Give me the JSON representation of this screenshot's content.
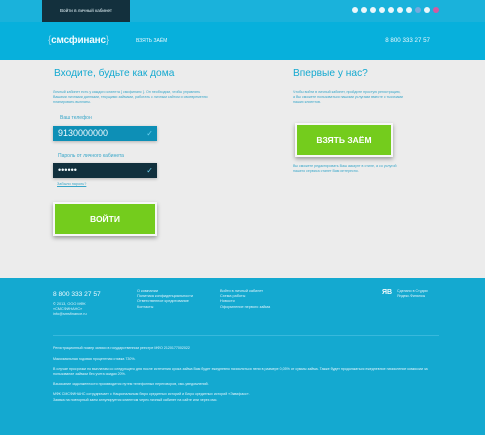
{
  "topbar": {
    "login_tab": "Войти в личный кабинет"
  },
  "header": {
    "logo_prefix": "{",
    "logo_text": "смсфинанс",
    "logo_suffix": "}",
    "loan_link": "ВЗЯТЬ ЗАЁМ",
    "phone": "8 800 333 27 57"
  },
  "login": {
    "title": "Входите, будьте как дома",
    "intro": "Личный кабинет есть у каждого клиента { смсфинанс }. Он необходим, чтобы управлять Вашими личными данными, текущими займами, работать с личным сайтом и своевременно планировать выплаты.",
    "phone_label": "Ваш телефон",
    "phone_value": "9130000000",
    "password_label": "Пароль от личного кабинета",
    "password_value": "••••••",
    "forgot": "Забыли пароль?",
    "button": "ВОЙТИ"
  },
  "signup": {
    "title": "Впервые у нас?",
    "intro": "Чтобы войти в личный кабинет, пройдите простую регистрацию, а Вы сможете пользоваться нашими услугами вместе с тысячами наших клиентов.",
    "button": "ВЗЯТЬ ЗАЁМ",
    "note": "Вы сможете редактировать Ваш аккаунт в стиле, а со услугой нашего сервиса станет Вам интересно."
  },
  "footer": {
    "phone": "8 800 333 27 57",
    "company": [
      "© 2013, ООО МФК",
      "«СМСФИНАНС»",
      "info@smsfinance.ru"
    ],
    "col1": [
      "О компании",
      "Политика конфиденциальности",
      "Ответственное кредитование",
      "Контакты"
    ],
    "col2": [
      "Войти в личный кабинет",
      "Схема работы",
      "Новости",
      "Оформление первого займа"
    ],
    "partner_logo": "ЯВ",
    "partner_text": [
      "Сделано в Студии",
      "Яндекс.Финансы"
    ],
    "legal": [
      "Регистрационный номер записи в государственном реестре МФО 2120177002022",
      "Максимальная годовая процентная ставка 730%.",
      "В случае просрочки по выплатам со следующего дня после истечения срока займа Вам будет ежедневно начисляться пени в размере 0,05% от суммы займа. Также будет продолжаться ежедневное начисление комиссии за пользование займом без учета скидки 20%.",
      "Взыскание задолженности производится путем телефонных переговоров, смс-уведомлений.",
      "МФК СМСФИНАНС сотрудничает с Национальным бюро кредитных историй и Бюро кредитных историй «Эквифакс».",
      "Заявка на повторный заем аннулируется клиентом через личный кабинет на сайте или через смс."
    ]
  }
}
